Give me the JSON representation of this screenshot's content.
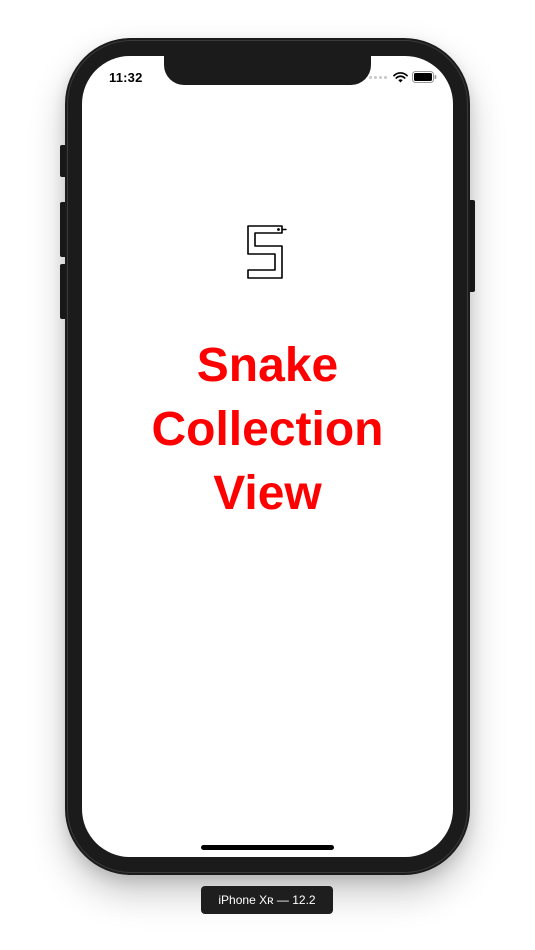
{
  "status_bar": {
    "time": "11:32",
    "icons": [
      "signal-dots-icon",
      "wifi-icon",
      "battery-icon"
    ]
  },
  "app": {
    "logo_icon": "snake-s-logo-icon",
    "title_lines": [
      "Snake",
      "Collection",
      "View"
    ],
    "title_color": "#ff0000"
  },
  "device": {
    "label": "iPhone Xʀ — 12.2"
  }
}
